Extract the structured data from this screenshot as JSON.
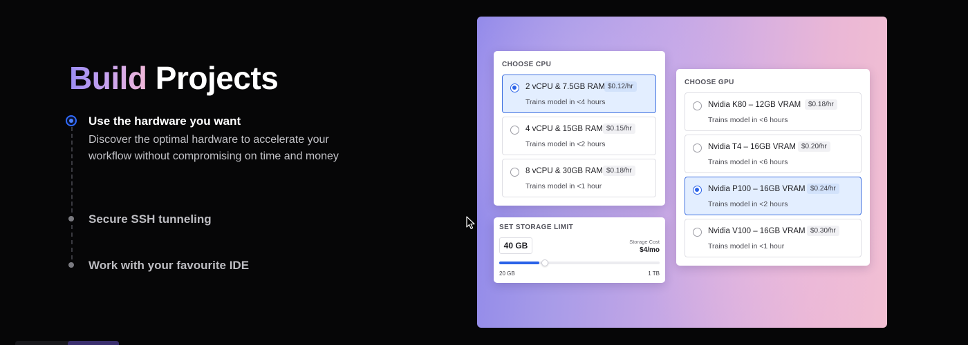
{
  "hero": {
    "title_accent": "Build",
    "title_rest": "Projects"
  },
  "steps": [
    {
      "title": "Use the hardware you want",
      "description": "Discover the optimal hardware to accelerate your workflow without compromising on time and money",
      "active": true
    },
    {
      "title": "Secure SSH tunneling",
      "active": false
    },
    {
      "title": "Work with your favourite IDE",
      "active": false
    }
  ],
  "cpu": {
    "heading": "CHOOSE CPU",
    "options": [
      {
        "name": "2 vCPU & 7.5GB RAM",
        "price": "$0.12/hr",
        "subtitle": "Trains model in <4 hours",
        "selected": true
      },
      {
        "name": "4 vCPU & 15GB RAM",
        "price": "$0.15/hr",
        "subtitle": "Trains model in <2 hours",
        "selected": false
      },
      {
        "name": "8 vCPU & 30GB RAM",
        "price": "$0.18/hr",
        "subtitle": "Trains model in <1 hour",
        "selected": false
      }
    ]
  },
  "storage": {
    "heading": "SET STORAGE LIMIT",
    "value": "40 GB",
    "cost_label": "Storage Cost",
    "cost": "$4/mo",
    "range_min": "20 GB",
    "range_max": "1 TB",
    "slider_fraction": 0.25
  },
  "gpu": {
    "heading": "CHOOSE GPU",
    "options": [
      {
        "name": "Nvidia K80 – 12GB VRAM",
        "price": "$0.18/hr",
        "subtitle": "Trains model in <6 hours",
        "selected": false
      },
      {
        "name": "Nvidia T4 – 16GB VRAM",
        "price": "$0.20/hr",
        "subtitle": "Trains model in <6 hours",
        "selected": false
      },
      {
        "name": "Nvidia P100 – 16GB VRAM",
        "price": "$0.24/hr",
        "subtitle": "Trains model in <2 hours",
        "selected": true
      },
      {
        "name": "Nvidia V100 – 16GB VRAM",
        "price": "$0.30/hr",
        "subtitle": "Trains model in <1 hour",
        "selected": false
      }
    ]
  },
  "colors": {
    "accent_blue": "#2a62e8",
    "selected_bg": "#e3eeff",
    "page_bg": "#060607"
  },
  "icons": {
    "cursor": "mouse-pointer-icon"
  }
}
